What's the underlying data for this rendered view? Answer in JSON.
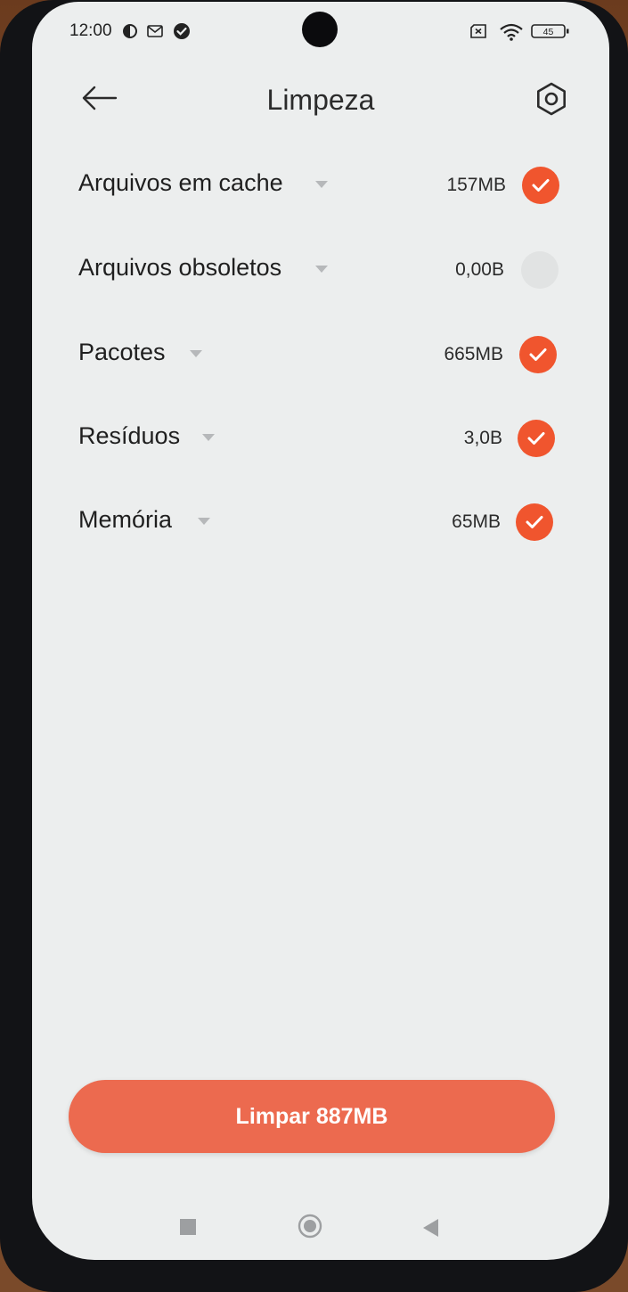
{
  "status_bar": {
    "time": "12:00",
    "battery": "45",
    "icons": [
      "data-saver-icon",
      "gmail-icon",
      "check-circle-icon",
      "no-sim-icon",
      "wifi-icon",
      "battery-icon"
    ]
  },
  "header": {
    "title": "Limpeza",
    "back_icon": "arrow-left-icon",
    "settings_icon": "settings-icon"
  },
  "items": [
    {
      "label": "Arquivos em cache",
      "size": "157MB",
      "checked": true
    },
    {
      "label": "Arquivos obsoletos",
      "size": "0,00B",
      "checked": false
    },
    {
      "label": "Pacotes",
      "size": "665MB",
      "checked": true
    },
    {
      "label": "Resíduos",
      "size": "3,0B",
      "checked": true
    },
    {
      "label": "Memória",
      "size": "65MB",
      "checked": true
    }
  ],
  "clean_button": {
    "label": "Limpar 887MB"
  },
  "colors": {
    "accent": "#f0552e",
    "button": "#ec6a4f",
    "background": "#eceeee"
  }
}
